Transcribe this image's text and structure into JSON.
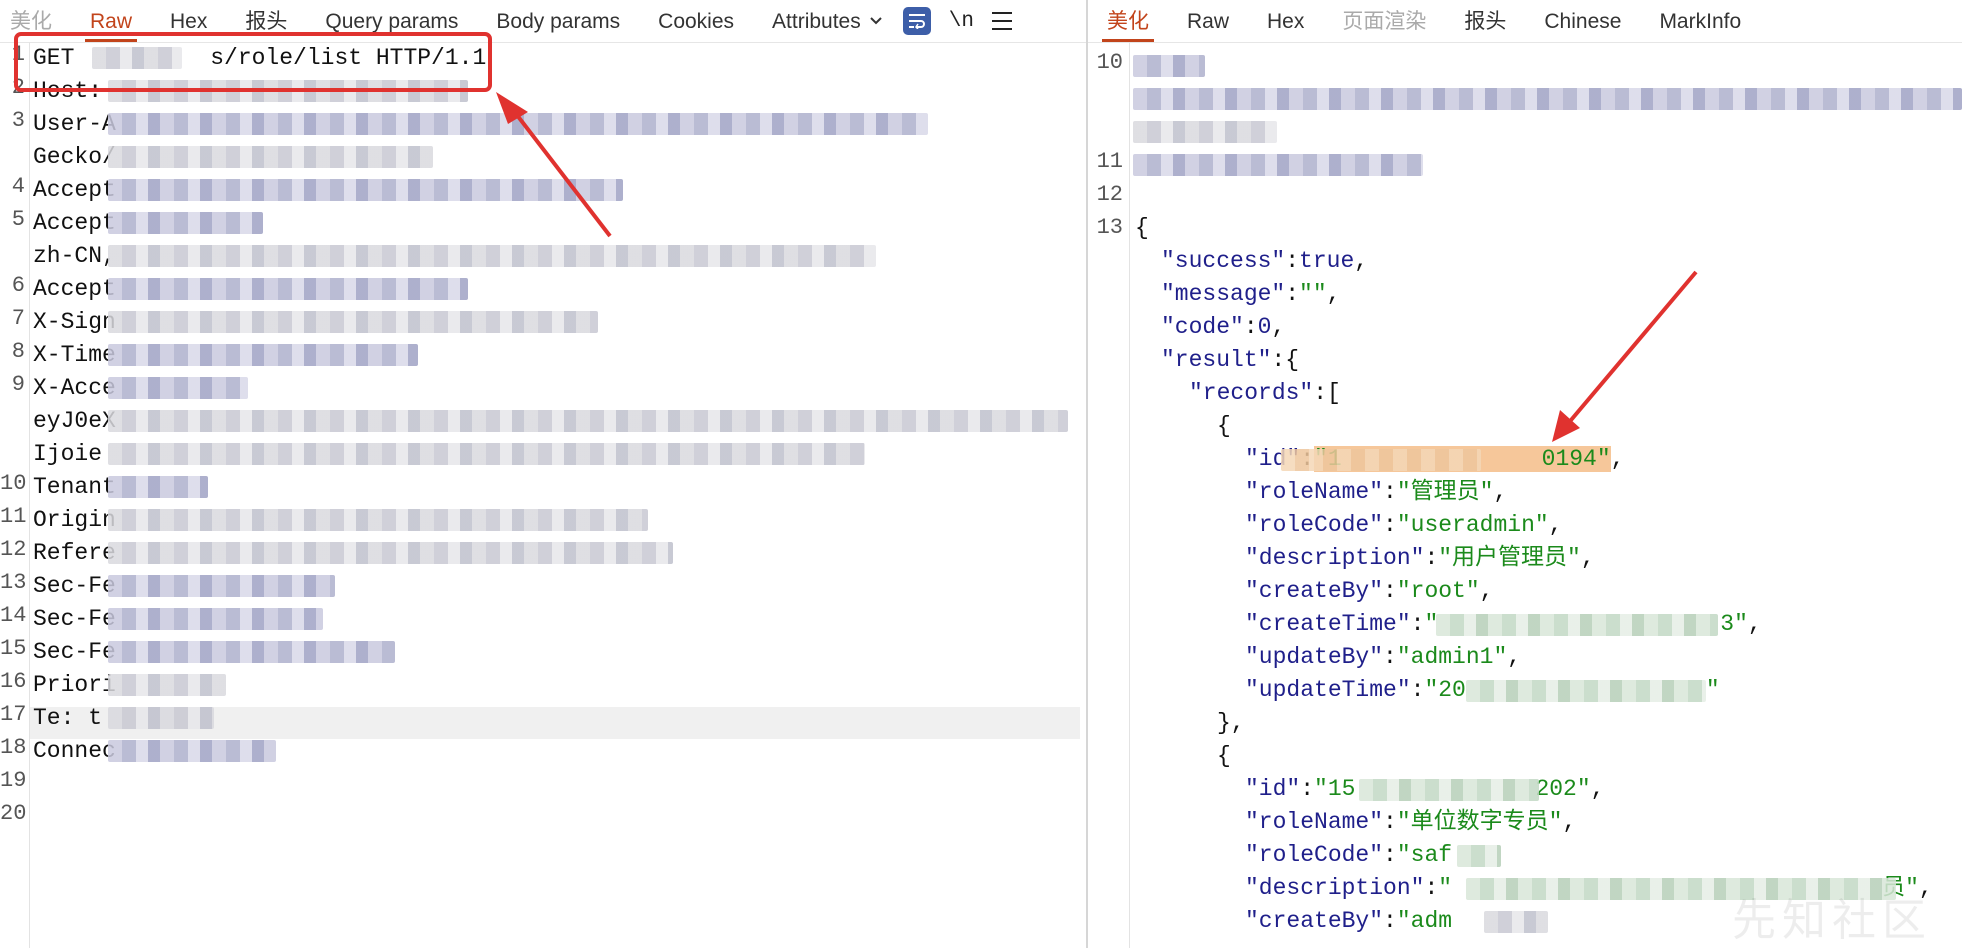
{
  "request_tabs": [
    {
      "label": "美化",
      "state": "cut"
    },
    {
      "label": "Raw",
      "state": "active"
    },
    {
      "label": "Hex",
      "state": "normal"
    },
    {
      "label": "报头",
      "state": "normal"
    },
    {
      "label": "Query params",
      "state": "normal"
    },
    {
      "label": "Body params",
      "state": "normal"
    },
    {
      "label": "Cookies",
      "state": "normal"
    },
    {
      "label": "Attributes",
      "state": "normal"
    }
  ],
  "request_toolbar": {
    "newline_label": "\\n"
  },
  "response_tabs": [
    {
      "label": "美化",
      "state": "active"
    },
    {
      "label": "Raw",
      "state": "normal"
    },
    {
      "label": "Hex",
      "state": "normal"
    },
    {
      "label": "页面渲染",
      "state": "dim"
    },
    {
      "label": "报头",
      "state": "normal"
    },
    {
      "label": "Chinese",
      "state": "normal"
    },
    {
      "label": "MarkInfo",
      "state": "normal"
    }
  ],
  "request_lines": [
    {
      "n": "1",
      "text": "GET ",
      "tail": "s/role/list HTTP/1.1"
    },
    {
      "n": "2",
      "text": "Host:"
    },
    {
      "n": "3",
      "text": "User-A"
    },
    {
      "n": "",
      "text": "Gecko/"
    },
    {
      "n": "4",
      "text": "Accept"
    },
    {
      "n": "5",
      "text": "Accept"
    },
    {
      "n": "",
      "text": "zh-CN,"
    },
    {
      "n": "6",
      "text": "Accept"
    },
    {
      "n": "7",
      "text": "X-Sign"
    },
    {
      "n": "8",
      "text": "X-Time"
    },
    {
      "n": "9",
      "text": "X-Acce"
    },
    {
      "n": "",
      "text": "eyJ0eX"
    },
    {
      "n": "",
      "text": "Ijoie"
    },
    {
      "n": "10",
      "text": "Tenant"
    },
    {
      "n": "11",
      "text": "Origin"
    },
    {
      "n": "12",
      "text": "Refere"
    },
    {
      "n": "13",
      "text": "Sec-Fe"
    },
    {
      "n": "14",
      "text": "Sec-Fe"
    },
    {
      "n": "15",
      "text": "Sec-Fe"
    },
    {
      "n": "16",
      "text": "Priori"
    },
    {
      "n": "17",
      "text": "Te: t"
    },
    {
      "n": "18",
      "text": "Connec"
    },
    {
      "n": "19",
      "text": ""
    },
    {
      "n": "20",
      "text": ""
    }
  ],
  "response_line_numbers": [
    "10",
    "11",
    "12",
    "13"
  ],
  "response_json": {
    "open_brace": "{",
    "success_key": "\"success\"",
    "success_val": "true",
    "message_key": "\"message\"",
    "message_val": "\"\"",
    "code_key": "\"code\"",
    "code_val": "0",
    "result_key": "\"result\"",
    "records_key": "\"records\"",
    "rec1": {
      "id_key": "\"id\"",
      "id_val_head": "\"1",
      "id_val_tail": "0194\"",
      "roleName_key": "\"roleName\"",
      "roleName_val": "\"管理员\"",
      "roleCode_key": "\"roleCode\"",
      "roleCode_val": "\"useradmin\"",
      "description_key": "\"description\"",
      "description_val": "\"用户管理员\"",
      "createBy_key": "\"createBy\"",
      "createBy_val": "\"root\"",
      "createTime_key": "\"createTime\"",
      "createTime_head": "\"",
      "createTime_tail": "3\"",
      "updateBy_key": "\"updateBy\"",
      "updateBy_val": "\"admin1\"",
      "updateTime_key": "\"updateTime\"",
      "updateTime_head": "\"20",
      "updateTime_tail": "\""
    },
    "rec2": {
      "id_key": "\"id\"",
      "id_val_head": "\"15",
      "id_val_tail": "202\"",
      "roleName_key": "\"roleName\"",
      "roleName_val": "\"单位数字专员\"",
      "roleCode_key": "\"roleCode\"",
      "roleCode_val": "\"saf",
      "description_key": "\"description\"",
      "description_head": "\"",
      "description_tail": "员\"",
      "createBy_key": "\"createBy\"",
      "createBy_val": "\"adm"
    }
  },
  "watermark": "先知社区",
  "colors": {
    "accent": "#c2441b",
    "annotation_red": "#e0322f",
    "highlight": "#f6c79a",
    "json_key": "#1f1f8a",
    "json_string": "#1b8a1b"
  }
}
